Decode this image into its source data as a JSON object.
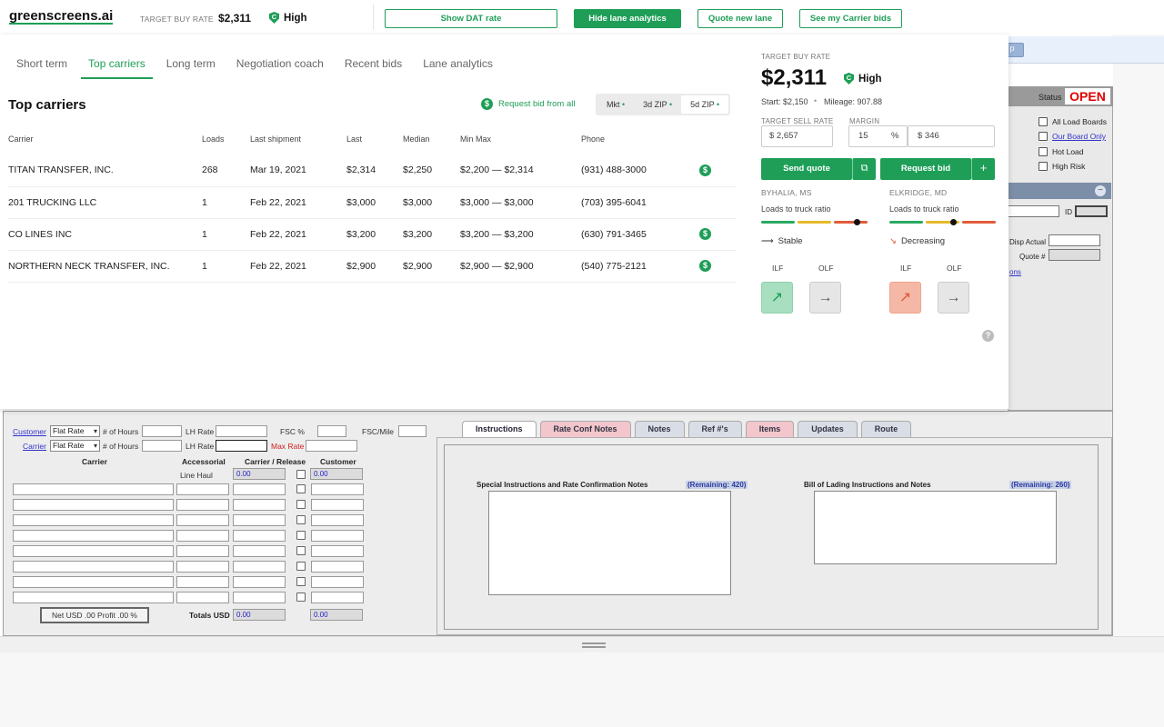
{
  "topbar": {
    "logo": "greenscreens.ai",
    "target_buy_rate_label": "TARGET BUY RATE",
    "target_buy_rate_value": "$2,311",
    "confidence_letter": "C",
    "confidence_label": "High",
    "buttons": {
      "show_dat": "Show DAT rate",
      "hide_lane": "Hide lane analytics",
      "quote_new_lane": "Quote new lane",
      "see_carrier_bids": "See my Carrier bids"
    }
  },
  "tabs": [
    "Short term",
    "Top carriers",
    "Long term",
    "Negotiation coach",
    "Recent bids",
    "Lane analytics"
  ],
  "active_tab": "Top carriers",
  "top_carriers": {
    "title": "Top carriers",
    "request_bid_all": "Request bid from all",
    "segments": [
      {
        "label": "Mkt",
        "active": false
      },
      {
        "label": "3d ZIP",
        "active": false
      },
      {
        "label": "5d ZIP",
        "active": true
      }
    ],
    "columns": [
      "Carrier",
      "Loads",
      "Last shipment",
      "Last",
      "Median",
      "Min Max",
      "Phone"
    ],
    "rows": [
      {
        "carrier": "TITAN TRANSFER, INC.",
        "loads": "268",
        "last_shipment": "Mar 19, 2021",
        "last": "$2,314",
        "median": "$2,250",
        "minmax": "$2,200 — $2,314",
        "phone": "(931) 488-3000",
        "bid_icon": true
      },
      {
        "carrier": "201 TRUCKING LLC",
        "loads": "1",
        "last_shipment": "Feb 22, 2021",
        "last": "$3,000",
        "median": "$3,000",
        "minmax": "$3,000 — $3,000",
        "phone": "(703) 395-6041",
        "bid_icon": false
      },
      {
        "carrier": "CO LINES INC",
        "loads": "1",
        "last_shipment": "Feb 22, 2021",
        "last": "$3,200",
        "median": "$3,200",
        "minmax": "$3,200 — $3,200",
        "phone": "(630) 791-3465",
        "bid_icon": true
      },
      {
        "carrier": "NORTHERN NECK TRANSFER, INC.",
        "loads": "1",
        "last_shipment": "Feb 22, 2021",
        "last": "$2,900",
        "median": "$2,900",
        "minmax": "$2,900 — $2,900",
        "phone": "(540) 775-2121",
        "bid_icon": true
      }
    ]
  },
  "rate_card": {
    "target_buy_rate_label": "TARGET BUY RATE",
    "target_buy_rate": "$2,311",
    "confidence_letter": "C",
    "confidence": "High",
    "start": "Start: $2,150",
    "mileage": "Mileage: 907.88",
    "target_sell_rate_label": "TARGET SELL RATE",
    "margin_label": "MARGIN",
    "sell_rate_value": "$ 2,657",
    "margin_pct": "15",
    "pct_symbol": "%",
    "margin_amount": "$ 346",
    "send_quote": "Send quote",
    "request_bid": "Request bid",
    "copy_icon": "⧉",
    "plus_icon": "+",
    "origin": {
      "city": "BYHALIA, MS",
      "ratio_label": "Loads to truck ratio",
      "ratio_fraction": 0.9,
      "trend_glyph": "⟶",
      "trend": "Stable",
      "ilf": "ILF",
      "olf": "OLF",
      "ilf_glyph": "↗",
      "olf_glyph": "→"
    },
    "destination": {
      "city": "ELKRIDGE, MD",
      "ratio_label": "Loads to truck ratio",
      "ratio_fraction": 0.6,
      "trend_glyph": "↘",
      "trend": "Decreasing",
      "ilf": "ILF",
      "olf": "OLF",
      "ilf_glyph": "↗",
      "olf_glyph": "→"
    },
    "help_glyph": "?"
  },
  "colors": {
    "brand": "#1e9e57",
    "ilf_up_green_bg": "#a8dfc0",
    "ilf_up_red_bg": "#f6b8a6",
    "neutral_bg": "#e6e6e6",
    "bar_green": "#2aa862",
    "bar_yellow": "#e8b92a",
    "bar_red": "#e05a3a"
  },
  "legacy": {
    "status_label": "Status",
    "status_value": "OPEN",
    "checkboxes": [
      "All Load Boards",
      "Our Board Only",
      "Hot Load",
      "High Risk"
    ],
    "id_label": "ID",
    "disp_actual_label": "Disp Actual",
    "quote_no_label": "Quote #",
    "side_link_fragment": "ons",
    "bluebar_btn": "p",
    "minus_glyph": "−",
    "bottom": {
      "customer_link": "Customer",
      "carrier_link": "Carrier",
      "flat_rate": "Flat Rate",
      "hours_label": "# of Hours",
      "lh_rate_label": "LH Rate",
      "fsc_pct_label": "FSC %",
      "fsc_mile_label": "FSC/Mile",
      "max_rate_label": "Max Rate",
      "col_carrier": "Carrier",
      "col_accessorial": "Accessorial",
      "col_carrier_release": "Carrier / Release",
      "col_customer": "Customer",
      "line_haul_label": "Line Haul",
      "zero": "0.00",
      "net_usd": "Net USD .00    Profit .00 %",
      "totals_usd": "Totals USD"
    },
    "tabs": [
      {
        "label": "Instructions",
        "style": "active"
      },
      {
        "label": "Rate Conf Notes",
        "style": "pink"
      },
      {
        "label": "Notes",
        "style": ""
      },
      {
        "label": "Ref #'s",
        "style": ""
      },
      {
        "label": "Items",
        "style": "pink"
      },
      {
        "label": "Updates",
        "style": ""
      },
      {
        "label": "Route",
        "style": ""
      }
    ],
    "special_instructions_label": "Special Instructions and Rate Confirmation Notes",
    "special_remaining": "(Remaining: 420)",
    "bol_label": "Bill of Lading Instructions and Notes",
    "bol_remaining": "(Remaining: 260)"
  }
}
